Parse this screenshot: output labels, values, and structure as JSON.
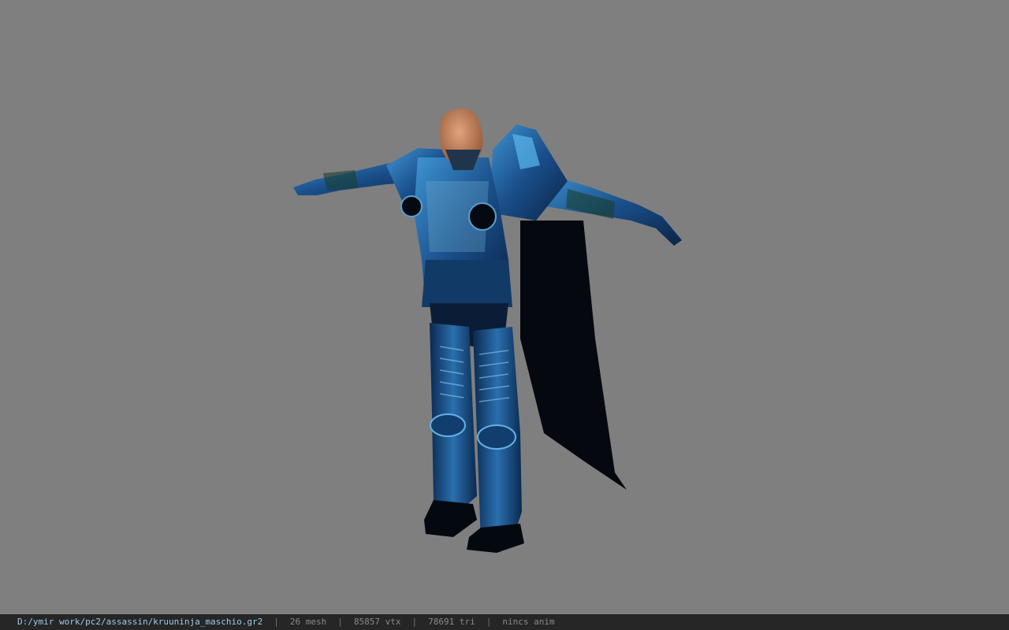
{
  "viewer": {
    "model": {
      "name": "kruuninja_maschio",
      "description_icon": "armored-character-model",
      "colors": {
        "background": "#7f7f7f",
        "armor_dark": "#0a2a4e",
        "armor_mid": "#1c5b9a",
        "armor_light": "#4aa5e0",
        "cape": "#050a12",
        "skin": "#c98a62"
      }
    }
  },
  "statusbar": {
    "path": "D:/ymir work/pc2/assassin/kruuninja_maschio.gr2",
    "separator": "|",
    "mesh": "26 mesh",
    "vtx": "85857 vtx",
    "tri": "78691 tri",
    "anim": "nincs anim"
  }
}
